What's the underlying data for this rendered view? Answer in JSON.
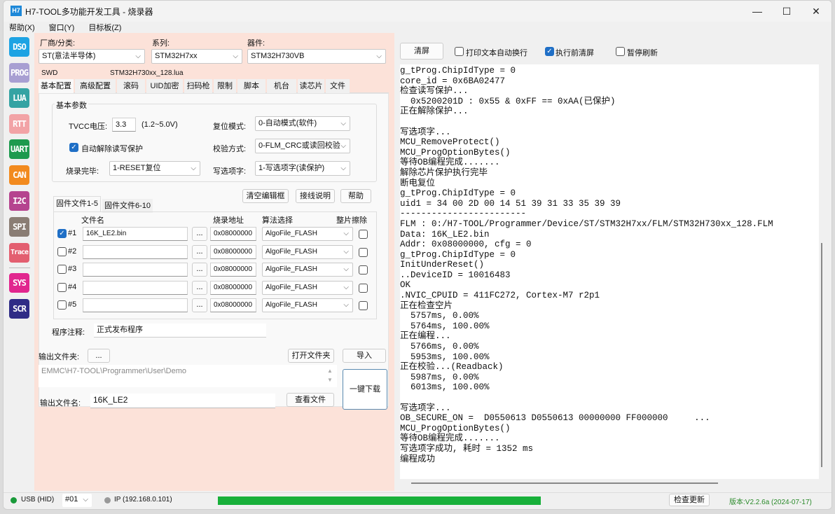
{
  "window": {
    "title": "H7-TOOL多功能开发工具 - 烧录器",
    "logo": "H7",
    "minimize_icon": "—",
    "maximize_icon": "☐",
    "close_icon": "✕"
  },
  "menu": [
    "帮助(X)",
    "窗口(Y)",
    "目标板(Z)"
  ],
  "sidebar": [
    {
      "label": "DSO",
      "color": "#1ea3e3"
    },
    {
      "label": "PROG",
      "color": "#a89fd2"
    },
    {
      "label": "LUA",
      "color": "#34a3a3"
    },
    {
      "label": "RTT",
      "color": "#f2a3a6"
    },
    {
      "label": "UART",
      "color": "#1d9a4e"
    },
    {
      "label": "CAN",
      "color": "#f28a1e"
    },
    {
      "label": "I2C",
      "color": "#b5448f"
    },
    {
      "label": "SPI",
      "color": "#8a7d74"
    },
    {
      "label": "Trace",
      "color": "#e35f70"
    },
    {
      "label": "SYS",
      "color": "#e1268e"
    },
    {
      "label": "SCR",
      "color": "#2f2c86"
    }
  ],
  "device": {
    "vendor_label": "厂商/分类:",
    "vendor": "ST(意法半导体)",
    "series_label": "系列:",
    "series": "STM32H7xx",
    "part_label": "器件:",
    "part": "STM32H730VB",
    "interface": "SWD",
    "lua_file": "STM32H730xx_128.lua"
  },
  "tabs": [
    "基本配置",
    "高级配置",
    "滚码",
    "UID加密",
    "扫码枪",
    "限制",
    "脚本",
    "机台",
    "读芯片",
    "文件"
  ],
  "basic": {
    "group_title": "基本参数",
    "tvcc_label": "TVCC电压:",
    "tvcc_value": "3.3",
    "tvcc_range": "(1.2~5.0V)",
    "auto_unprotect_label": "自动解除读写保护",
    "auto_unprotect_checked": true,
    "reset_mode_label": "复位模式:",
    "reset_mode": "0-自动模式(软件)",
    "verify_label": "校验方式:",
    "verify": "0-FLM_CRC或读回校验",
    "finish_label": "烧录完毕:",
    "finish": "1-RESET复位",
    "ob_label": "写选项字:",
    "ob": "1-写选项字(读保护)"
  },
  "fw_buttons": {
    "clear": "清空编辑框",
    "wiring": "接线说明",
    "help": "帮助"
  },
  "fw_tabs": [
    "固件文件1-5",
    "固件文件6-10"
  ],
  "fw_headers": {
    "file": "文件名",
    "addr": "烧录地址",
    "algo": "算法选择",
    "erase": "整片擦除"
  },
  "fw_rows": [
    {
      "id": "#1",
      "checked": true,
      "file": "16K_LE2.bin",
      "browse": "...",
      "addr": "0x08000000",
      "algo": "AlgoFile_FLASH"
    },
    {
      "id": "#2",
      "checked": false,
      "file": "",
      "browse": "...",
      "addr": "0x08000000",
      "algo": "AlgoFile_FLASH"
    },
    {
      "id": "#3",
      "checked": false,
      "file": "",
      "browse": "...",
      "addr": "0x08000000",
      "algo": "AlgoFile_FLASH"
    },
    {
      "id": "#4",
      "checked": false,
      "file": "",
      "browse": "...",
      "addr": "0x08000000",
      "algo": "AlgoFile_FLASH"
    },
    {
      "id": "#5",
      "checked": false,
      "file": "",
      "browse": "...",
      "addr": "0x08000000",
      "algo": "AlgoFile_FLASH"
    }
  ],
  "comment": {
    "label": "程序注释:",
    "value": "正式发布程序"
  },
  "output": {
    "folder_label": "输出文件夹:",
    "browse": "...",
    "open_folder": "打开文件夹",
    "import": "导入",
    "path": "EMMC\\H7-TOOL\\Programmer\\User\\Demo",
    "name_label": "输出文件名:",
    "name": "16K_LE2",
    "view_file": "查看文件",
    "download": "一键下载"
  },
  "log_toolbar": {
    "clear": "清屏",
    "wrap_label": "打印文本自动换行",
    "wrap": false,
    "clear_before_label": "执行前清屏",
    "clear_before": true,
    "pause_label": "暂停刷新",
    "pause": false
  },
  "log": [
    "g_tProg.ChipIdType = 0",
    "core_id = 0x6BA02477",
    "检查读写保护...",
    "  0x5200201D : 0x55 & 0xFF == 0xAA(已保护)",
    "正在解除保护...",
    "",
    "写选项字...",
    "MCU_RemoveProtect()",
    "MCU_ProgOptionBytes()",
    "等待OB编程完成.......",
    "解除芯片保护执行完毕",
    "断电复位",
    "g_tProg.ChipIdType = 0",
    "uid1 = 34 00 2D 00 14 51 39 31 33 35 39 39",
    "------------------------",
    "FLM : 0:/H7-TOOL/Programmer/Device/ST/STM32H7xx/FLM/STM32H730xx_128.FLM",
    "Data: 16K_LE2.bin",
    "Addr: 0x08000000, cfg = 0",
    "g_tProg.ChipIdType = 0",
    "InitUnderReset()",
    "..DeviceID = 10016483",
    "OK",
    ".NVIC_CPUID = 411FC272, Cortex-M7 r2p1",
    "正在检查空片",
    "  5757ms, 0.00%",
    "  5764ms, 100.00%",
    "正在编程...",
    "  5766ms, 0.00%",
    "  5953ms, 100.00%",
    "正在校验...(Readback)",
    "  5987ms, 0.00%",
    "  6013ms, 100.00%",
    "",
    "写选项字...",
    "OB_SECURE_ON =  D0550613 D0550613 00000000 FF000000     ...",
    "MCU_ProgOptionBytes()",
    "等待OB编程完成.......",
    "写选项字成功, 耗时 = 1352 ms",
    "编程成功"
  ],
  "status": {
    "usb": "USB (HID)",
    "usb_color": "#1a9a3a",
    "port": "#01",
    "ip": "IP (192.168.0.101)",
    "progress_percent": 72,
    "progress_color": "#18b03a",
    "check_update": "检查更新",
    "version": "版本:V2.2.6a (2024-07-17)",
    "version_color": "#2a8a2a"
  }
}
